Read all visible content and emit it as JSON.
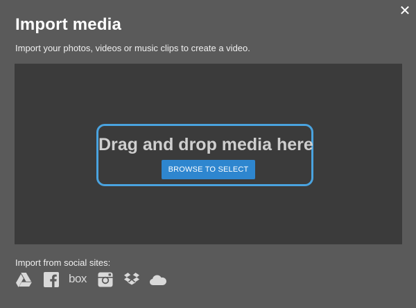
{
  "dialog": {
    "close_symbol": "✕",
    "title": "Import media",
    "subtitle": "Import your photos, videos or music clips to create a video."
  },
  "dropzone": {
    "text": "Drag and drop media here",
    "browse_label": "BROWSE TO SELECT"
  },
  "social": {
    "label": "Import from social sites:",
    "icons": [
      "google-drive-icon",
      "facebook-icon",
      "box-icon",
      "instagram-icon",
      "dropbox-icon",
      "onedrive-icon"
    ],
    "box_text": "box"
  },
  "colors": {
    "dialog_bg": "#5a5a5a",
    "dropzone_bg": "#3b3b3b",
    "accent_border": "#4aa3df",
    "button_bg": "#2e86cf"
  }
}
